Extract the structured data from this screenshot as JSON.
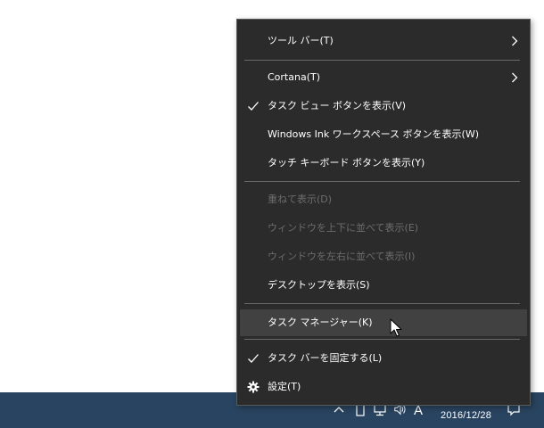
{
  "menu": {
    "toolbars": "ツール バー(T)",
    "cortana": "Cortana(T)",
    "task_view": "タスク ビュー ボタンを表示(V)",
    "ink_workspace": "Windows Ink ワークスペース ボタンを表示(W)",
    "touch_keyboard": "タッチ キーボード ボタンを表示(Y)",
    "cascade": "重ねて表示(D)",
    "stack": "ウィンドウを上下に並べて表示(E)",
    "side_by_side": "ウィンドウを左右に並べて表示(I)",
    "show_desktop": "デスクトップを表示(S)",
    "task_manager": "タスク マネージャー(K)",
    "lock_taskbar": "タスク バーを固定する(L)",
    "settings": "設定(T)"
  },
  "taskbar": {
    "ime_indicator": "A",
    "date": "2016/12/28"
  },
  "icons": {
    "checkmark": "check-icon",
    "submenu": "chevron-right-icon",
    "settings": "gear-icon",
    "pointer": "mouse-pointer-icon"
  },
  "colors": {
    "menu_bg": "#2b2b2b",
    "menu_hover": "#414141",
    "disabled_text": "#6d6d6d",
    "taskbar_bg": "#294460"
  }
}
